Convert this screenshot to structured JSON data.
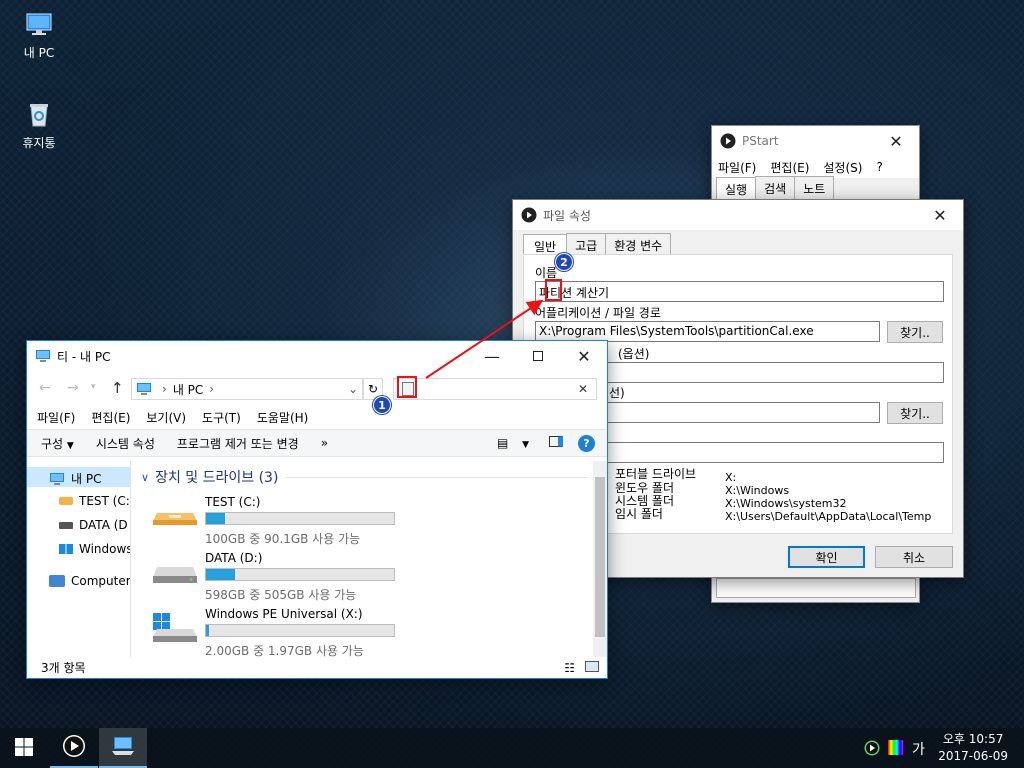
{
  "desktop": {
    "icons": [
      {
        "label": "내 PC",
        "icon": "computer-icon"
      },
      {
        "label": "휴지통",
        "icon": "recycle-bin-icon"
      }
    ]
  },
  "pstart": {
    "title": "PStart",
    "menu": [
      "파일(F)",
      "편집(E)",
      "설정(S)",
      "?"
    ],
    "tabs": [
      "실행",
      "검색",
      "노트"
    ]
  },
  "props": {
    "title": "파일 속성",
    "tabs": [
      "일반",
      "고급",
      "환경 변수"
    ],
    "name_label": "이름",
    "name_value": "파티션 계산기",
    "path_label": "어플리케이션 / 파일 경로",
    "path_value": "X:\\Program Files\\SystemTools\\partitionCal.exe",
    "browse_label": "찾기..",
    "param_label": "(옵션)",
    "workdir_label": "선)",
    "browse2_label": "찾기..",
    "env": [
      {
        "key": "포터블 드라이브",
        "value": "X:"
      },
      {
        "key": "윈도우 폴더",
        "value": "X:\\Windows"
      },
      {
        "key": "시스템 폴더",
        "value": "X:\\Windows\\system32"
      },
      {
        "key": "임시 폴더",
        "value": "X:\\Users\\Default\\AppData\\Local\\Temp"
      }
    ],
    "ok_label": "확인",
    "cancel_label": "취소"
  },
  "explorer": {
    "title": "티 - 내 PC",
    "address": [
      "내 PC"
    ],
    "menu": [
      "파일(F)",
      "편집(E)",
      "보기(V)",
      "도구(T)",
      "도움말(H)"
    ],
    "commands": [
      "구성",
      "시스템 속성",
      "프로그램 제거 또는 변경"
    ],
    "nav_items": [
      {
        "label": "내 PC",
        "icon": "computer-icon"
      },
      {
        "label": "TEST (C:)",
        "icon": "drive-icon"
      },
      {
        "label": "DATA (D",
        "icon": "drive-icon"
      },
      {
        "label": "Windows",
        "icon": "windows-drive-icon"
      },
      {
        "label": "Computers",
        "icon": "network-icon"
      }
    ],
    "group_header": "장치 및 드라이브 (3)",
    "drives": [
      {
        "name": "TEST (C:)",
        "free_text": "100GB 중 90.1GB 사용 가능",
        "used_fraction": 0.099,
        "icon": "usb-drive-icon"
      },
      {
        "name": "DATA (D:)",
        "free_text": "598GB 중 505GB 사용 가능",
        "used_fraction": 0.156,
        "icon": "hard-drive-icon"
      },
      {
        "name": "Windows PE Universal (X:)",
        "free_text": "2.00GB 중 1.97GB 사용 가능",
        "used_fraction": 0.015,
        "icon": "windows-drive-icon"
      }
    ],
    "status": "3개 항목"
  },
  "callouts": [
    "1",
    "2"
  ],
  "taskbar": {
    "tray_ime": "가",
    "time": "오후 10:57",
    "date": "2017-06-09"
  },
  "colors": {
    "accent": "#1883d7",
    "progress": "#26a0da",
    "callout": "#e11111",
    "badge": "#1f49b8"
  }
}
